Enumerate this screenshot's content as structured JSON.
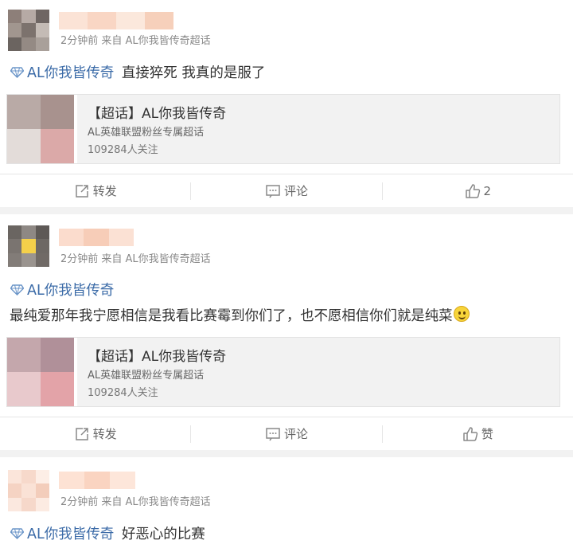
{
  "topic_name": "AL你我皆传奇",
  "posts": [
    {
      "meta": "2分钟前 来自 AL你我皆传奇超话",
      "text": "直接猝死 我真的是服了",
      "card": {
        "title": "【超话】AL你我皆传奇",
        "desc": "AL英雄联盟粉丝专属超话",
        "followers": "109284人关注"
      },
      "actions": {
        "repost": "转发",
        "comment": "评论",
        "like": "2"
      }
    },
    {
      "meta": "2分钟前 来自 AL你我皆传奇超话",
      "text": "最纯爱那年我宁愿相信是我看比赛霉到你们了，也不愿相信你们就是纯菜",
      "card": {
        "title": "【超话】AL你我皆传奇",
        "desc": "AL英雄联盟粉丝专属超话",
        "followers": "109284人关注"
      },
      "actions": {
        "repost": "转发",
        "comment": "评论",
        "like": "赞"
      }
    },
    {
      "meta": "2分钟前 来自 AL你我皆传奇超话",
      "text": "好恶心的比赛"
    }
  ],
  "colors": {
    "topic_link": "#3a6aa7",
    "background": "#f2f2f2",
    "card_bg": "#f2f2f2"
  },
  "icons": [
    "diamond-icon",
    "repost-icon",
    "comment-icon",
    "like-icon",
    "smile-emoji-icon"
  ]
}
